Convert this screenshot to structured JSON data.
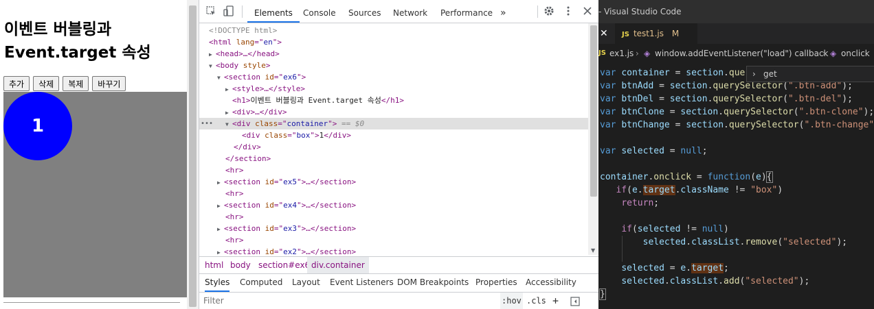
{
  "page": {
    "heading_line1": "이벤트 버블링과",
    "heading_line2": "Event.target 속성",
    "buttons": [
      "추가",
      "삭제",
      "복제",
      "바꾸기"
    ],
    "box_text": "1",
    "colors": {
      "container": "#808080",
      "box": "#0000ff"
    }
  },
  "devtools": {
    "tabs": [
      "Elements",
      "Console",
      "Sources",
      "Network",
      "Performance"
    ],
    "active_tab": "Elements",
    "more_tabs_icon": "»",
    "icons": [
      "inspect-icon",
      "device-toggle-icon",
      "gear-icon",
      "more-vert-icon",
      "close-icon"
    ],
    "dom_lines": [
      {
        "raw": "<!DOCTYPE html>"
      },
      {
        "open": "html",
        "attr": "lang",
        "val": "en"
      },
      {
        "collapsed": "<head>…</head>"
      },
      {
        "open": "body",
        "attr": "style",
        "val": ""
      },
      {
        "open": "section",
        "attr": "id",
        "val": "ex6"
      },
      {
        "collapsed": "<style>…</style>"
      },
      {
        "h1_text": "이벤트 버블링과 Event.target 속성"
      },
      {
        "collapsed": "<div>…</div>"
      },
      {
        "open": "div",
        "attr": "class",
        "val": "container",
        "suffix": "== $0"
      },
      {
        "box": "1"
      },
      {
        "close": "</div>"
      },
      {
        "close": "</section>"
      },
      {
        "tag": "<hr>"
      },
      {
        "section": "ex5"
      },
      {
        "tag": "<hr>"
      },
      {
        "section": "ex4"
      },
      {
        "tag": "<hr>"
      },
      {
        "section": "ex3"
      },
      {
        "tag": "<hr>"
      },
      {
        "section": "ex2"
      }
    ],
    "breadcrumbs": [
      "html",
      "body",
      "section#ex6",
      "div.container"
    ],
    "subtabs": [
      "Styles",
      "Computed",
      "Layout",
      "Event Listeners",
      "DOM Breakpoints",
      "Properties",
      "Accessibility"
    ],
    "active_subtab": "Styles",
    "filter_placeholder": "Filter",
    "filter_buttons": [
      ":hov",
      ".cls",
      "+"
    ]
  },
  "vscode": {
    "title": "- Visual Studio Code",
    "tab": {
      "icon": "JS",
      "name": "test1.js",
      "status": "M"
    },
    "breadcrumb": {
      "file_icon": "JS",
      "file": "ex1.js",
      "callback": "window.addEventListener(\"load\") callback",
      "symbol": "onclick"
    },
    "suggest": "get",
    "code_lines": [
      "var container = section.quer",
      "var btnAdd = section.querySelector(\".btn-add\");",
      "var btnDel = section.querySelector(\".btn-del\");",
      "var btnClone = section.querySelector(\".btn-clone\");",
      "var btnChange = section.querySelector(\".btn-change\");",
      "",
      "var selected = null;",
      "",
      "container.onclick = function(e){",
      "    if(e.target.className != \"box\")",
      "    return;",
      "",
      "    if(selected != null)",
      "        selected.classList.remove(\"selected\");",
      "",
      "    selected = e.target;",
      "    selected.classList.add(\"selected\");",
      "}"
    ]
  }
}
